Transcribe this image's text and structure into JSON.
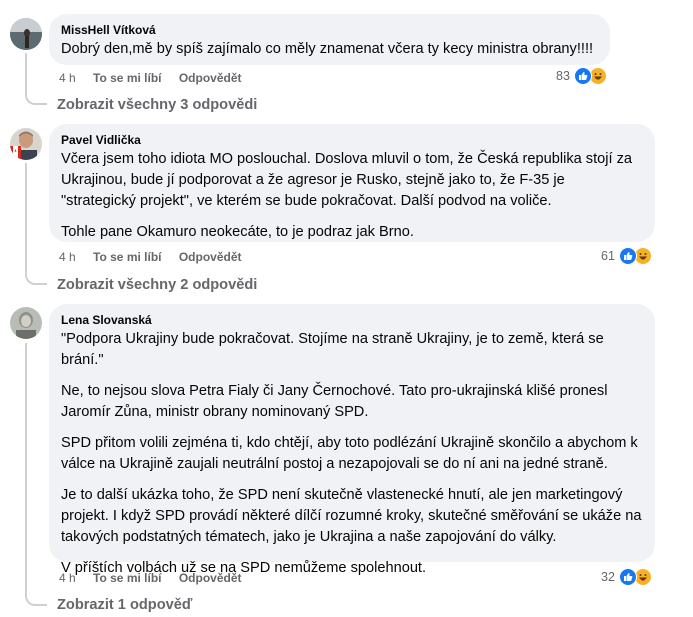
{
  "comments": [
    {
      "author": "MissHell Vítková",
      "paragraphs": [
        "Dobrý den,mě by spíš zajímalo co měly znamenat včera ty kecy ministra obrany!!!!"
      ],
      "time": "4 h",
      "like_label": "To se mi líbí",
      "reply_label": "Odpovědět",
      "reaction_count": "83",
      "reactions": [
        "like-icon",
        "haha-icon"
      ],
      "replies_link": "Zobrazit všechny 3 odpovědi"
    },
    {
      "author": "Pavel Vidlička",
      "paragraphs": [
        "Včera jsem toho idiota MO poslouchal. Doslova mluvil o tom, že Česká republika stojí za Ukrajinou, bude jí podporovat a že agresor je Rusko, stejně jako to, že F-35 je \"strategický projekt\", ve kterém se bude pokračovat. Další podvod na voliče.",
        "Tohle pane Okamuro neokecáte, to je podraz jak Brno."
      ],
      "time": "4 h",
      "like_label": "To se mi líbí",
      "reply_label": "Odpovědět",
      "reaction_count": "61",
      "reactions": [
        "like-icon",
        "haha-icon"
      ],
      "replies_link": "Zobrazit všechny 2 odpovědi"
    },
    {
      "author": "Lena Slovanská",
      "paragraphs": [
        "\"Podpora Ukrajiny bude pokračovat. Stojíme na straně Ukrajiny, je to země, která se brání.\"",
        "Ne, to nejsou slova Petra Fialy či Jany Černochové. Tato pro-ukrajinská klišé pronesl Jaromír Zůna, ministr obrany nominovaný SPD.",
        "SPD přitom volili zejména ti, kdo chtějí, aby toto podlézání Ukrajině skončilo a abychom k válce na Ukrajině zaujali neutrální postoj a nezapojovali se do ní ani na jedné straně.",
        "Je to další ukázka toho, že SPD není skutečně vlastenecké hnutí, ale jen marketingový projekt. I když SPD provádí některé dílčí rozumné kroky, skutečné směřování se ukáže na takových podstatných tématech, jako je Ukrajina a naše zapojování do války.",
        "V příštích volbách už se na SPD nemůžeme spolehnout."
      ],
      "time": "4 h",
      "like_label": "To se mi líbí",
      "reply_label": "Odpovědět",
      "reaction_count": "32",
      "reactions": [
        "like-icon",
        "haha-icon"
      ],
      "replies_link": "Zobrazit 1 odpověď"
    }
  ]
}
